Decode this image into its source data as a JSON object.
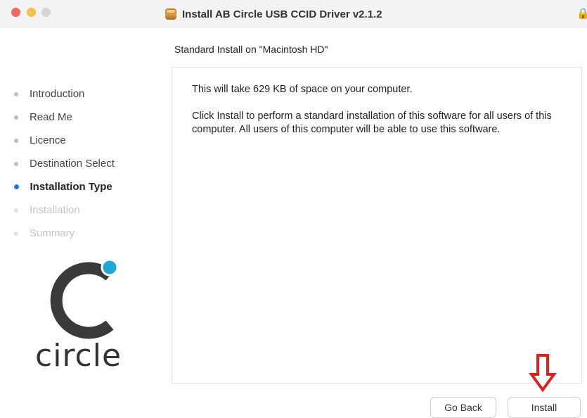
{
  "window": {
    "title": "Install AB Circle USB CCID Driver v2.1.2",
    "icon": "package-icon",
    "lock_icon": "lock-icon"
  },
  "subtitle": "Standard Install on \"Macintosh HD\"",
  "sidebar": {
    "steps": [
      {
        "label": "Introduction",
        "state": "done"
      },
      {
        "label": "Read Me",
        "state": "done"
      },
      {
        "label": "Licence",
        "state": "done"
      },
      {
        "label": "Destination Select",
        "state": "done"
      },
      {
        "label": "Installation Type",
        "state": "current"
      },
      {
        "label": "Installation",
        "state": "future"
      },
      {
        "label": "Summary",
        "state": "future"
      }
    ]
  },
  "logo": {
    "text": "circle",
    "accent_color": "#1fa8d6"
  },
  "content": {
    "line1": "This will take 629 KB of space on your computer.",
    "line2": "Click Install to perform a standard installation of this software for all users of this computer. All users of this computer will be able to use this software."
  },
  "buttons": {
    "back": "Go Back",
    "install": "Install"
  },
  "annotation": {
    "arrow_color": "#d9231f",
    "arrow_icon": "down-arrow-icon"
  }
}
